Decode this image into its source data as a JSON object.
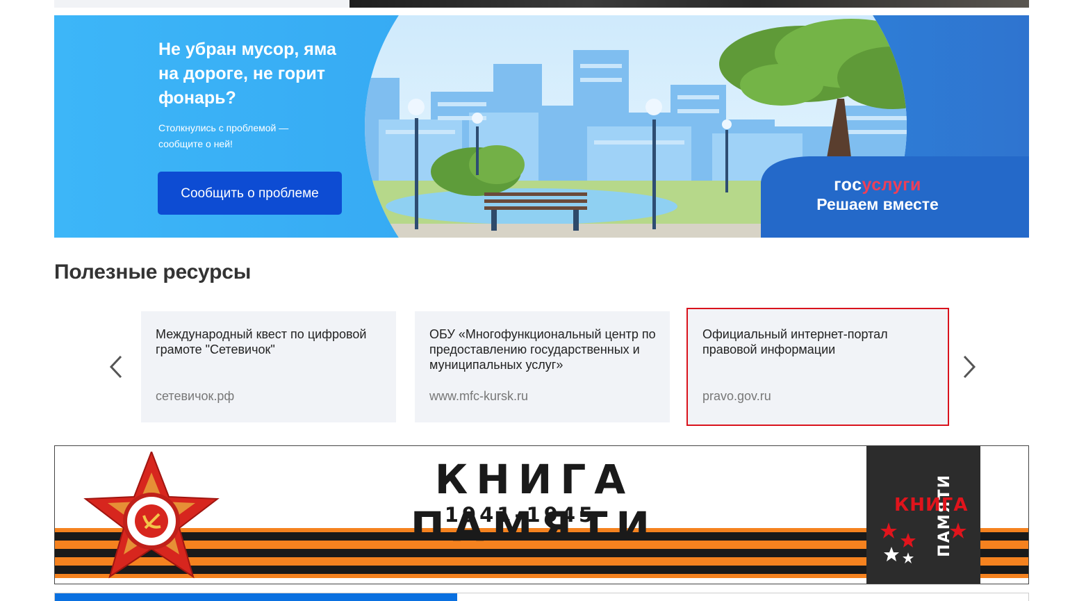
{
  "banner": {
    "title": "Не убран мусор, яма на дороге, не горит фонарь?",
    "subtitle": "Столкнулись с проблемой — сообщите о ней!",
    "button_label": "Сообщить о проблеме",
    "brand_gos": "гос",
    "brand_uslugi": "услуги",
    "brand_tagline": "Решаем вместе"
  },
  "resources": {
    "title": "Полезные ресурсы",
    "cards": [
      {
        "title": "Международный квест по цифровой грамоте \"Сетевичок\"",
        "url": "сетевичок.рф"
      },
      {
        "title": "ОБУ «Многофункциональный центр по предоставлению государственных и муниципальных услуг»",
        "url": "www.mfc-kursk.ru"
      },
      {
        "title": "Официальный интернет-портал правовой информации",
        "url": "pravo.gov.ru"
      }
    ]
  },
  "memory_book": {
    "title": "КНИГА ПАМЯТИ",
    "years": "1941-1945",
    "logo_word1": "КНИГА",
    "logo_word2": "ПАМЯТИ"
  },
  "colors": {
    "primary_button": "#0d4cd3",
    "brand_red": "#ee3f58",
    "selection_outline": "#d9121c"
  }
}
